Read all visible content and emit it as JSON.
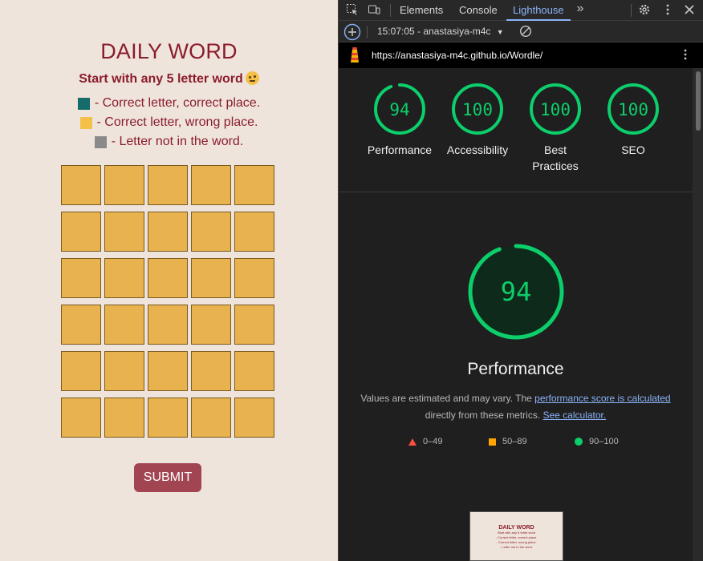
{
  "game": {
    "title": "DAILY WORD",
    "subtitle": "Start with any 5 letter word",
    "subtitle_emoji": "face-with-monocle",
    "legend": [
      {
        "color": "#156c6a",
        "text": "- Correct letter, correct place."
      },
      {
        "color": "#f4c04a",
        "text": "- Correct letter, wrong place."
      },
      {
        "color": "#8a8a8a",
        "text": "- Letter not in the word."
      }
    ],
    "grid_rows": 6,
    "grid_cols": 5,
    "tile_color": "#e8b24e",
    "submit_label": "SUBMIT"
  },
  "devtools": {
    "tabs": [
      "Elements",
      "Console",
      "Lighthouse"
    ],
    "active_tab": "Lighthouse",
    "more_tabs_icon": "chevrons-right-icon",
    "report_select": "15:07:05 - anastasiya-m4c",
    "url": "https://anastasiya-m4c.github.io/Wordle/",
    "scores": [
      {
        "label": "Performance",
        "value": "94"
      },
      {
        "label": "Accessibility",
        "value": "100"
      },
      {
        "label": "Best Practices",
        "value": "100"
      },
      {
        "label": "SEO",
        "value": "100"
      }
    ],
    "performance": {
      "score": "94",
      "title": "Performance",
      "desc_prefix": "Values are estimated and may vary. The ",
      "desc_link1": "performance score is calculated",
      "desc_middle": " directly from these metrics. ",
      "desc_link2": "See calculator."
    },
    "ranges": [
      {
        "icon": "red-triangle",
        "label": "0–49"
      },
      {
        "icon": "orange-square",
        "label": "50–89"
      },
      {
        "icon": "green-circle",
        "label": "90–100"
      }
    ],
    "thumbnail": {
      "title": "DAILY WORD",
      "lines": [
        "Start with any 5 letter word",
        "- Correct letter, correct place.",
        "- Correct letter, wrong place.",
        "- Letter not in the word."
      ]
    },
    "colors": {
      "pass": "#0cce6b",
      "pass_bg": "#0d3b24",
      "accent": "#8ab4f8"
    }
  }
}
